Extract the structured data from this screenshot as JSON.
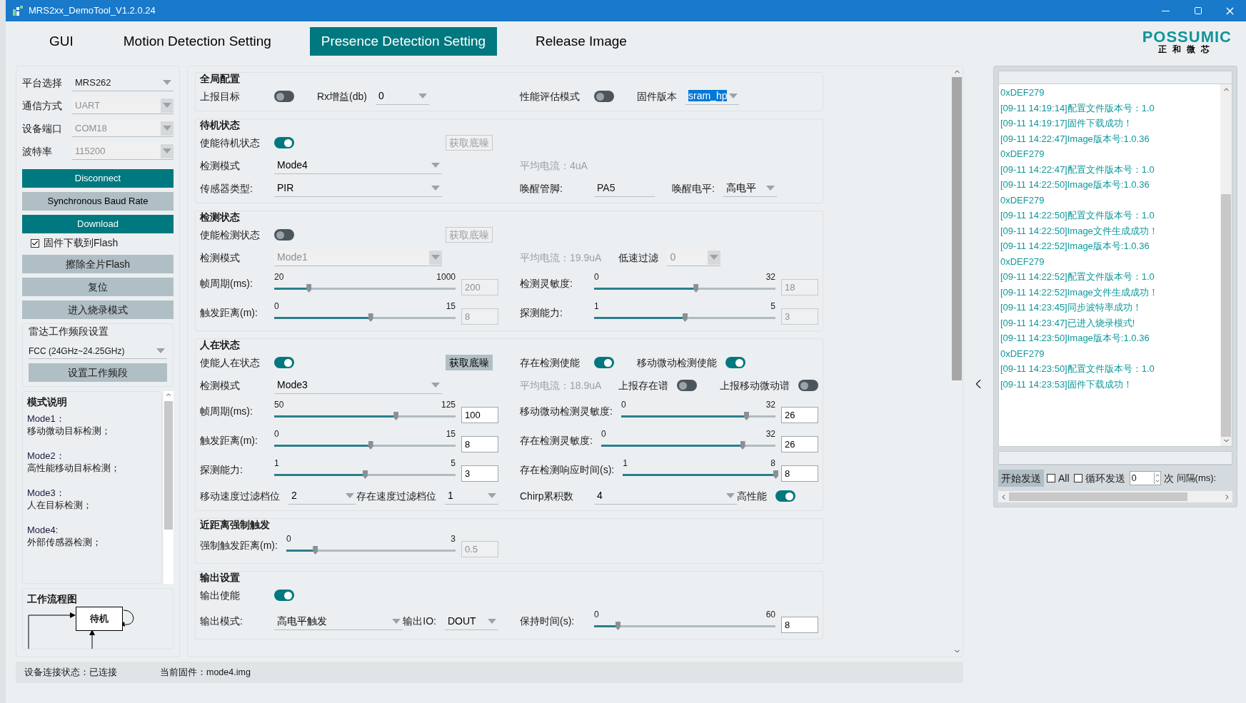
{
  "window": {
    "title": "MRS2xx_DemoTool_V1.2.0.24"
  },
  "tabs": [
    {
      "label": "GUI",
      "selected": false
    },
    {
      "label": "Motion Detection Setting",
      "selected": false
    },
    {
      "label": "Presence Detection Setting",
      "selected": true
    },
    {
      "label": "Release Image",
      "selected": false
    }
  ],
  "logo": {
    "brand": "POSSUMIC",
    "sub": "正和微芯"
  },
  "sidebar": {
    "fields": [
      {
        "label": "平台选择",
        "value": "MRS262",
        "disabled": false
      },
      {
        "label": "通信方式",
        "value": "UART",
        "disabled": true
      },
      {
        "label": "设备端口",
        "value": "COM18",
        "disabled": true
      },
      {
        "label": "波特率",
        "value": "115200",
        "disabled": true
      }
    ],
    "buttons": [
      {
        "label": "Disconnect",
        "kind": "primary"
      },
      {
        "label": "Synchronous Baud Rate",
        "kind": "secondary"
      },
      {
        "label": "Download",
        "kind": "primary"
      }
    ],
    "flash_checkbox": {
      "label": "固件下载到Flash",
      "checked": true
    },
    "actions": [
      "擦除全片Flash",
      "复位",
      "进入烧录模式"
    ],
    "band": {
      "title": "雷达工作频段设置",
      "value": "FCC (24GHz~24.25GHz)",
      "button": "设置工作频段"
    },
    "modes": {
      "title": "模式说明",
      "items": [
        {
          "name": "Mode1：",
          "desc": "移动微动目标检测；"
        },
        {
          "name": "Mode2：",
          "desc": "高性能移动目标检测；"
        },
        {
          "name": "Mode3：",
          "desc": "人在目标检测；"
        },
        {
          "name": "Mode4:",
          "desc": "外部传感器检测；"
        }
      ]
    },
    "flow": {
      "title": "工作流程图",
      "node": "待机"
    }
  },
  "sections": [
    {
      "title": "全局配置",
      "rows": [
        {
          "left": [
            {
              "kind": "label",
              "text": "上报目标"
            },
            {
              "kind": "toggle",
              "on": false
            },
            {
              "kind": "label",
              "text": "Rx增益(db)"
            },
            {
              "kind": "select",
              "value": "0",
              "disabled": false
            }
          ],
          "right": [
            {
              "kind": "label",
              "text": "性能评估模式"
            },
            {
              "kind": "toggle",
              "on": false
            },
            {
              "kind": "label",
              "text": "固件版本"
            },
            {
              "kind": "select",
              "value": "sram_hp",
              "disabled": false,
              "highlighted": true
            }
          ]
        }
      ]
    },
    {
      "title": "待机状态",
      "rows": [
        {
          "left": [
            {
              "kind": "label",
              "text": "使能待机状态"
            },
            {
              "kind": "toggle",
              "on": true
            },
            {
              "kind": "button",
              "label": "获取底噪",
              "disabled": true
            }
          ],
          "right": []
        },
        {
          "left": [
            {
              "kind": "label",
              "text": "检测模式"
            },
            {
              "kind": "select",
              "value": "Mode4",
              "disabled": false
            }
          ],
          "right": [
            {
              "kind": "readout",
              "text": "平均电流：4uA"
            }
          ]
        },
        {
          "left": [
            {
              "kind": "label",
              "text": "传感器类型:"
            },
            {
              "kind": "select",
              "value": "PIR",
              "disabled": false
            }
          ],
          "right": [
            {
              "kind": "label",
              "text": "唤醒管脚:"
            },
            {
              "kind": "input",
              "value": "PA5"
            },
            {
              "kind": "label",
              "text": "唤醒电平:"
            },
            {
              "kind": "select",
              "value": "高电平",
              "disabled": false
            }
          ]
        }
      ]
    },
    {
      "title": "检测状态",
      "rows": [
        {
          "left": [
            {
              "kind": "label",
              "text": "使能检测状态"
            },
            {
              "kind": "toggle",
              "on": false
            },
            {
              "kind": "button",
              "label": "获取底噪",
              "disabled": true
            }
          ],
          "right": []
        },
        {
          "left": [
            {
              "kind": "label",
              "text": "检测模式"
            },
            {
              "kind": "select",
              "value": "Mode1",
              "disabled": true
            }
          ],
          "right": [
            {
              "kind": "readout",
              "text": "平均电流：19.9uA"
            },
            {
              "kind": "label",
              "text": "低速过滤"
            },
            {
              "kind": "select",
              "value": "0",
              "disabled": true
            }
          ]
        },
        {
          "left": [
            {
              "kind": "label",
              "text": "帧周期(ms):"
            },
            {
              "kind": "slider",
              "min": "20",
              "max": "1000",
              "level": 0.19,
              "value": "200",
              "disabled": true
            }
          ],
          "right": [
            {
              "kind": "label",
              "text": "检测灵敏度:"
            },
            {
              "kind": "slider",
              "min": "0",
              "max": "32",
              "level": 0.56,
              "value": "18",
              "disabled": true
            }
          ]
        },
        {
          "left": [
            {
              "kind": "label",
              "text": "触发距离(m):"
            },
            {
              "kind": "slider",
              "min": "0",
              "max": "15",
              "level": 0.53,
              "value": "8",
              "disabled": true
            }
          ],
          "right": [
            {
              "kind": "label",
              "text": "探测能力:"
            },
            {
              "kind": "slider",
              "min": "1",
              "max": "5",
              "level": 0.5,
              "value": "3",
              "disabled": true
            }
          ]
        }
      ]
    },
    {
      "title": "人在状态",
      "rows": [
        {
          "left": [
            {
              "kind": "label",
              "text": "使能人在状态"
            },
            {
              "kind": "toggle",
              "on": true
            },
            {
              "kind": "button",
              "label": "获取底噪",
              "disabled": false
            }
          ],
          "right": [
            {
              "kind": "label",
              "text": "存在检测使能"
            },
            {
              "kind": "toggle",
              "on": true
            },
            {
              "kind": "label",
              "text": "移动微动检测使能"
            },
            {
              "kind": "toggle",
              "on": true
            }
          ]
        },
        {
          "left": [
            {
              "kind": "label",
              "text": "检测模式"
            },
            {
              "kind": "select",
              "value": "Mode3",
              "disabled": false
            }
          ],
          "right": [
            {
              "kind": "readout",
              "text": "平均电流：18.9uA"
            },
            {
              "kind": "label",
              "text": "上报存在谱"
            },
            {
              "kind": "toggle",
              "on": false
            },
            {
              "kind": "label",
              "text": "上报移动微动谱"
            },
            {
              "kind": "toggle",
              "on": false
            }
          ]
        },
        {
          "left": [
            {
              "kind": "label",
              "text": "帧周期(ms):"
            },
            {
              "kind": "slider",
              "min": "50",
              "max": "125",
              "level": 0.67,
              "value": "100",
              "disabled": false
            }
          ],
          "right": [
            {
              "kind": "label",
              "text": "移动微动检测灵敏度:"
            },
            {
              "kind": "slider",
              "min": "0",
              "max": "32",
              "level": 0.81,
              "value": "26",
              "disabled": false
            }
          ]
        },
        {
          "left": [
            {
              "kind": "label",
              "text": "触发距离(m):"
            },
            {
              "kind": "slider",
              "min": "0",
              "max": "15",
              "level": 0.53,
              "value": "8",
              "disabled": false
            }
          ],
          "right": [
            {
              "kind": "label",
              "text": "存在检测灵敏度:"
            },
            {
              "kind": "slider",
              "min": "0",
              "max": "32",
              "level": 0.81,
              "value": "26",
              "disabled": false
            }
          ]
        },
        {
          "left": [
            {
              "kind": "label",
              "text": "探测能力:"
            },
            {
              "kind": "slider",
              "min": "1",
              "max": "5",
              "level": 0.5,
              "value": "3",
              "disabled": false
            }
          ],
          "right": [
            {
              "kind": "label",
              "text": "存在检测响应时间(s):"
            },
            {
              "kind": "slider",
              "min": "1",
              "max": "8",
              "level": 1.0,
              "value": "8",
              "disabled": false
            }
          ]
        },
        {
          "left": [
            {
              "kind": "label",
              "text": "移动速度过滤档位"
            },
            {
              "kind": "select",
              "value": "2",
              "disabled": false
            },
            {
              "kind": "label",
              "text": "存在速度过滤档位"
            },
            {
              "kind": "select",
              "value": "1",
              "disabled": false
            }
          ],
          "right": [
            {
              "kind": "label",
              "text": "Chirp累积数"
            },
            {
              "kind": "select",
              "value": "4",
              "disabled": false
            },
            {
              "kind": "label",
              "text": "高性能"
            },
            {
              "kind": "toggle",
              "on": true
            }
          ]
        }
      ]
    },
    {
      "title": "近距离强制触发",
      "rows": [
        {
          "left": [
            {
              "kind": "label",
              "text": "强制触发距离(m):"
            },
            {
              "kind": "slider",
              "min": "0",
              "max": "3",
              "level": 0.17,
              "value": "0.5",
              "disabled": true
            }
          ],
          "right": []
        }
      ]
    },
    {
      "title": "输出设置",
      "rows": [
        {
          "left": [
            {
              "kind": "label",
              "text": "输出使能"
            },
            {
              "kind": "toggle",
              "on": true
            }
          ],
          "right": []
        },
        {
          "left": [
            {
              "kind": "label",
              "text": "输出模式:"
            },
            {
              "kind": "select",
              "value": "高电平触发",
              "disabled": false
            },
            {
              "kind": "label",
              "text": "输出IO:"
            },
            {
              "kind": "select",
              "value": "DOUT",
              "disabled": false
            }
          ],
          "right": [
            {
              "kind": "label",
              "text": "保持时间(s):"
            },
            {
              "kind": "slider",
              "min": "0",
              "max": "60",
              "level": 0.13,
              "value": "8",
              "disabled": false
            }
          ]
        }
      ]
    }
  ],
  "status_bar": [
    "设备连接状态：已连接",
    "当前固件：mode4.img"
  ],
  "log": [
    "0xDEF279",
    "[09-11 14:19:14]配置文件版本号：1.0",
    "[09-11 14:19:17]固件下载成功！",
    "[09-11 14:22:47]Image版本号:1.0.36",
    "0xDEF279",
    "[09-11 14:22:47]配置文件版本号：1.0",
    "[09-11 14:22:50]Image版本号:1.0.36",
    "0xDEF279",
    "[09-11 14:22:50]配置文件版本号：1.0",
    "[09-11 14:22:50]Image文件生成成功！",
    "[09-11 14:22:52]Image版本号:1.0.36",
    "0xDEF279",
    "[09-11 14:22:52]配置文件版本号：1.0",
    "[09-11 14:22:52]Image文件生成成功！",
    "[09-11 14:23:45]同步波特率成功！",
    "[09-11 14:23:47]已进入烧录模式!",
    "[09-11 14:23:50]Image版本号:1.0.36",
    "0xDEF279",
    "[09-11 14:23:50]配置文件版本号：1.0",
    "[09-11 14:23:53]固件下载成功！"
  ],
  "send": {
    "button": "开始发送",
    "all": {
      "label": "All",
      "checked": false
    },
    "loop": {
      "label": "循环发送",
      "checked": false
    },
    "count": "0",
    "count_unit": "次",
    "interval_label": "间隔(ms):"
  }
}
